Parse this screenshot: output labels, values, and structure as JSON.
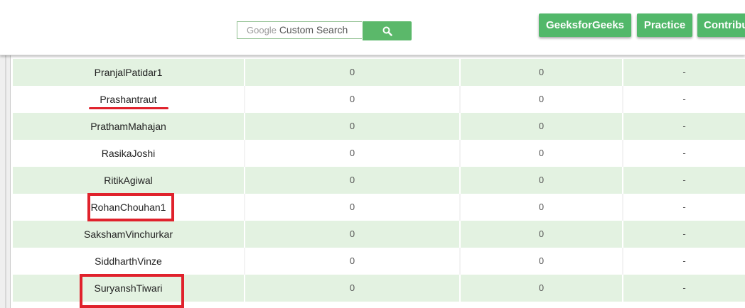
{
  "search": {
    "brand": "Google",
    "placeholder": "Custom Search",
    "button_icon": "search-icon",
    "button_color": "#5bb86a"
  },
  "nav": {
    "buttons": [
      "GeeksforGeeks",
      "Practice",
      "Contribu"
    ],
    "color": "#52b86a"
  },
  "table": {
    "row_alt_color": "#e3f2e1",
    "rows": [
      {
        "name": "PranjalPatidar1",
        "c2": "0",
        "c3": "0",
        "c4": "-"
      },
      {
        "name": "Prashantraut",
        "c2": "0",
        "c3": "0",
        "c4": "-"
      },
      {
        "name": "PrathamMahajan",
        "c2": "0",
        "c3": "0",
        "c4": "-"
      },
      {
        "name": "RasikaJoshi",
        "c2": "0",
        "c3": "0",
        "c4": "-"
      },
      {
        "name": "RitikAgiwal",
        "c2": "0",
        "c3": "0",
        "c4": "-"
      },
      {
        "name": "RohanChouhan1",
        "c2": "0",
        "c3": "0",
        "c4": "-"
      },
      {
        "name": "SakshamVinchurkar",
        "c2": "0",
        "c3": "0",
        "c4": "-"
      },
      {
        "name": "SiddharthVinze",
        "c2": "0",
        "c3": "0",
        "c4": "-"
      },
      {
        "name": "SuryanshTiwari",
        "c2": "0",
        "c3": "0",
        "c4": "-"
      }
    ]
  },
  "annotations": {
    "color": "#e0222c",
    "underlined": "Prashantraut",
    "boxed": [
      "RohanChouhan1",
      "SuryanshTiwari"
    ]
  }
}
